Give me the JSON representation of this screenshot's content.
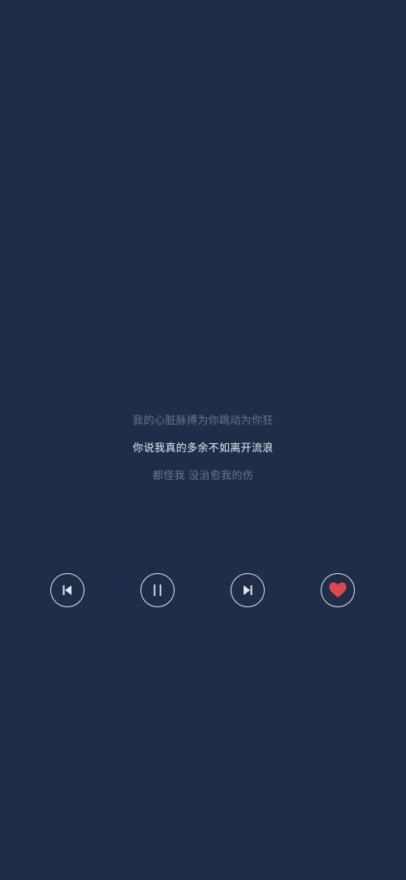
{
  "lyrics": {
    "previous_line": "我的心脏脉搏为你跳动为你狂",
    "current_line": "你说我真的多余不如离开流浪",
    "next_line": "都怪我 没治愈我的伤"
  },
  "controls": {
    "previous_icon": "skip-previous-icon",
    "pause_icon": "pause-icon",
    "next_icon": "skip-next-icon",
    "like_icon": "heart-icon"
  },
  "colors": {
    "background": "#202d48",
    "lyric_dim": "#6d7688",
    "lyric_active": "#e9ecf2",
    "icon_stroke": "#e4e7ee",
    "heart": "#e0474c"
  }
}
